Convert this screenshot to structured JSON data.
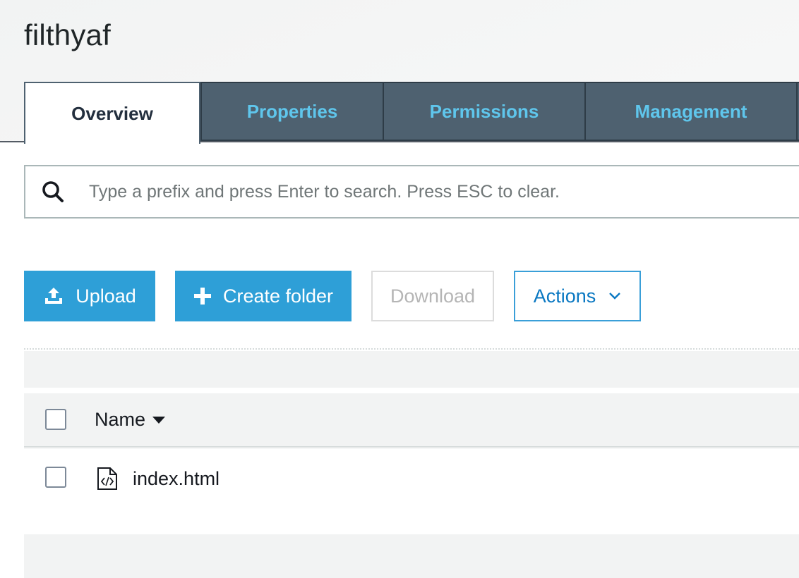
{
  "bucket": {
    "name": "filthyaf"
  },
  "tabs": [
    {
      "label": "Overview",
      "active": true
    },
    {
      "label": "Properties",
      "active": false
    },
    {
      "label": "Permissions",
      "active": false
    },
    {
      "label": "Management",
      "active": false
    }
  ],
  "search": {
    "placeholder": "Type a prefix and press Enter to search. Press ESC to clear.",
    "value": ""
  },
  "toolbar": {
    "upload_label": "Upload",
    "create_folder_label": "Create folder",
    "download_label": "Download",
    "actions_label": "Actions"
  },
  "table": {
    "columns": [
      {
        "label": "Name",
        "sort": "descending"
      }
    ],
    "rows": [
      {
        "name": "index.html",
        "type": "html-file",
        "selected": false
      }
    ]
  },
  "colors": {
    "tab_inactive_bg": "#4e6170",
    "tab_inactive_text": "#5fc6ec",
    "primary_button": "#2e9fd7",
    "link_blue": "#0a78c2"
  },
  "icons": {
    "search": "search-icon",
    "upload": "upload-icon",
    "create_folder": "plus-icon",
    "actions_dropdown": "chevron-down-icon",
    "sort": "sort-caret-down-icon",
    "file": "html-file-icon"
  }
}
